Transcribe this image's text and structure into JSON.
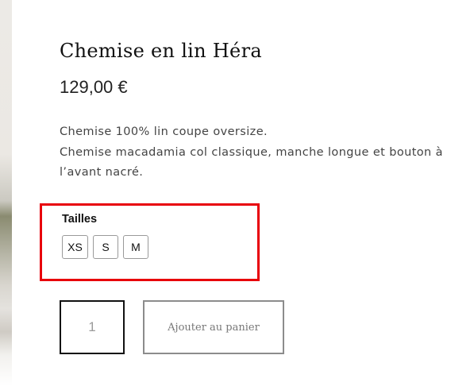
{
  "product": {
    "title": "Chemise en lin Héra",
    "price": "129,00 €",
    "description": [
      "Chemise 100% lin coupe oversize.",
      "Chemise macadamia col classique, manche longue et bouton à",
      "l’avant nacré."
    ]
  },
  "sizes": {
    "label": "Tailles",
    "options": [
      "XS",
      "S",
      "M"
    ],
    "highlight_color": "#e8000b"
  },
  "cart": {
    "quantity": "1",
    "add_label": "Ajouter au panier"
  }
}
